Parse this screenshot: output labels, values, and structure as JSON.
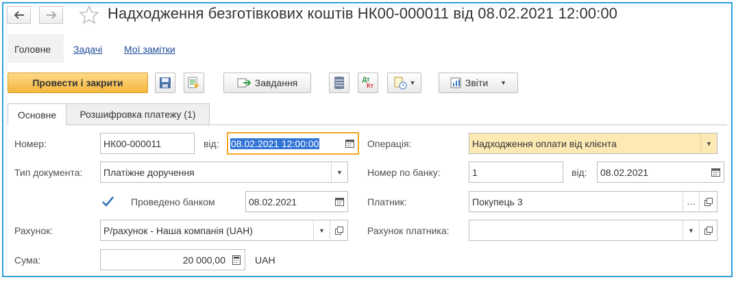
{
  "nav": {
    "back_icon": "arrow-left-icon",
    "forward_icon": "arrow-right-icon",
    "favorite_icon": "star-icon"
  },
  "title": "Надходження безготівкових коштів НК00-000011 від 08.02.2021 12:00:00",
  "sections": {
    "main": "Головне",
    "tasks": "Задачі",
    "notes": "Мої замітки"
  },
  "toolbar": {
    "post_close": "Провести і закрити",
    "task": "Завдання",
    "reports": "Звіти",
    "dtkt_top": "Дт",
    "dtkt_bottom": "Кт"
  },
  "tabs": {
    "main": "Основне",
    "payment": "Розшифровка платежу (1)"
  },
  "form": {
    "number_label": "Номер:",
    "number_value": "НК00-000011",
    "from_label": "від:",
    "date_value": "08.02.2021 12:00:00",
    "doc_type_label": "Тип документа:",
    "doc_type_value": "Платіжне доручення",
    "posted_label": "Проведено банком",
    "posted_checked": true,
    "posted_date": "08.02.2021",
    "account_label": "Рахунок:",
    "account_value": "Р/рахунок - Наша компанія (UAH)",
    "sum_label": "Сума:",
    "sum_value": "20 000,00",
    "currency": "UAH",
    "operation_label": "Операція:",
    "operation_value": "Надходження оплати від клієнта",
    "bank_no_label": "Номер по банку:",
    "bank_no_value": "1",
    "bank_from_label": "від:",
    "bank_date_value": "08.02.2021",
    "payer_label": "Платник:",
    "payer_value": "Покупець 3",
    "payer_account_label": "Рахунок платника:",
    "payer_account_value": ""
  },
  "colors": {
    "frame": "#2ea1dd",
    "primary_button": "#f3b73c",
    "highlight_field": "#fde9b4",
    "selection": "#3375d6",
    "link": "#1d4c9c"
  }
}
